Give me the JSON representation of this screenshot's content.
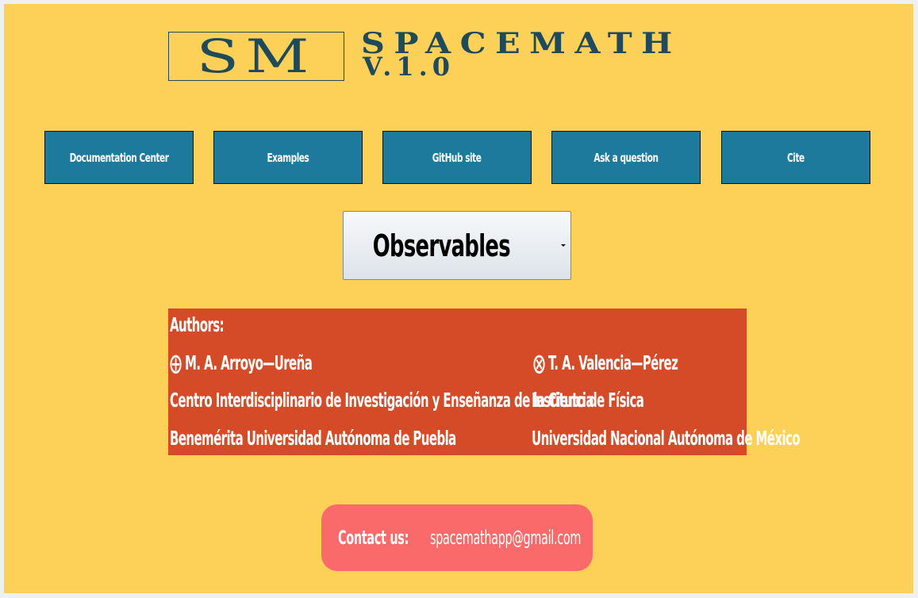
{
  "logo": {
    "mark": "SM",
    "title": "SPACEMATH",
    "version": "V.1.0"
  },
  "nav": [
    {
      "label": "Documentation Center"
    },
    {
      "label": "Examples"
    },
    {
      "label": "GitHub site"
    },
    {
      "label": "Ask a question"
    },
    {
      "label": "Cite"
    }
  ],
  "dropdown": {
    "selected": "Observables"
  },
  "authors": {
    "heading": "Authors:",
    "author1": {
      "symbol": "⨁",
      "name": "M. A. Arroyo—Ureña",
      "institute": "Centro Interdisciplinario de Investigación y Enseñanza de la Ciencia",
      "university": "Benemérita Universidad Autónoma de Puebla"
    },
    "author2": {
      "symbol": "⨂",
      "name": "T. A. Valencia—Pérez",
      "institute": "Instituto de Física",
      "university": "Universidad Nacional Autónoma de México"
    }
  },
  "contact": {
    "label": "Contact us:",
    "email": "spacemathapp@gmail.com"
  },
  "colors": {
    "background": "#fdd158",
    "nav_button": "#1d7a9c",
    "authors_panel": "#d54b28",
    "contact_panel": "#fb6a6a",
    "logo": "#1f4a5c"
  }
}
